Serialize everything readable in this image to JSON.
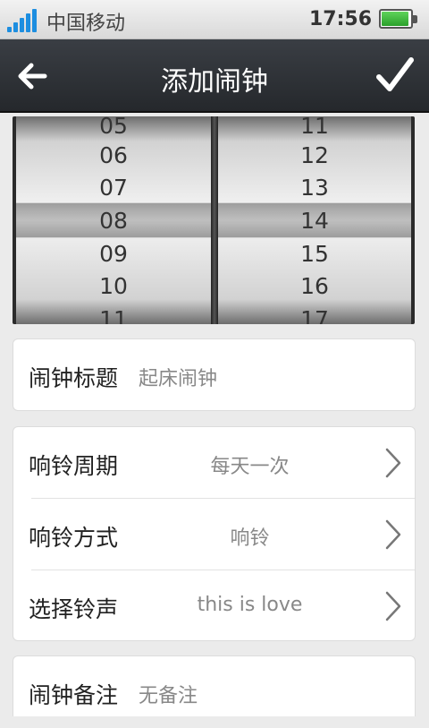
{
  "status_bar": {
    "carrier": "中国移动",
    "time": "17:56",
    "icons": {
      "signal": "signal-icon",
      "battery": "battery-icon"
    }
  },
  "title_bar": {
    "title": "添加闹钟",
    "back_icon": "arrow-left-icon",
    "confirm_icon": "checkmark-icon"
  },
  "time_picker": {
    "hours": [
      "05",
      "06",
      "07",
      "08",
      "09",
      "10",
      "11"
    ],
    "minutes": [
      "11",
      "12",
      "13",
      "14",
      "15",
      "16",
      "17"
    ],
    "selected_hour": "08",
    "selected_minute": "14"
  },
  "settings": {
    "title_row": {
      "label": "闹钟标题",
      "value": "起床闹钟"
    },
    "cycle_row": {
      "label": "响铃周期",
      "value": "每天一次"
    },
    "mode_row": {
      "label": "响铃方式",
      "value": "响铃"
    },
    "ringtone_row": {
      "label": "选择铃声",
      "value": "this is love"
    },
    "note_row": {
      "label": "闹钟备注",
      "value": "无备注"
    }
  }
}
